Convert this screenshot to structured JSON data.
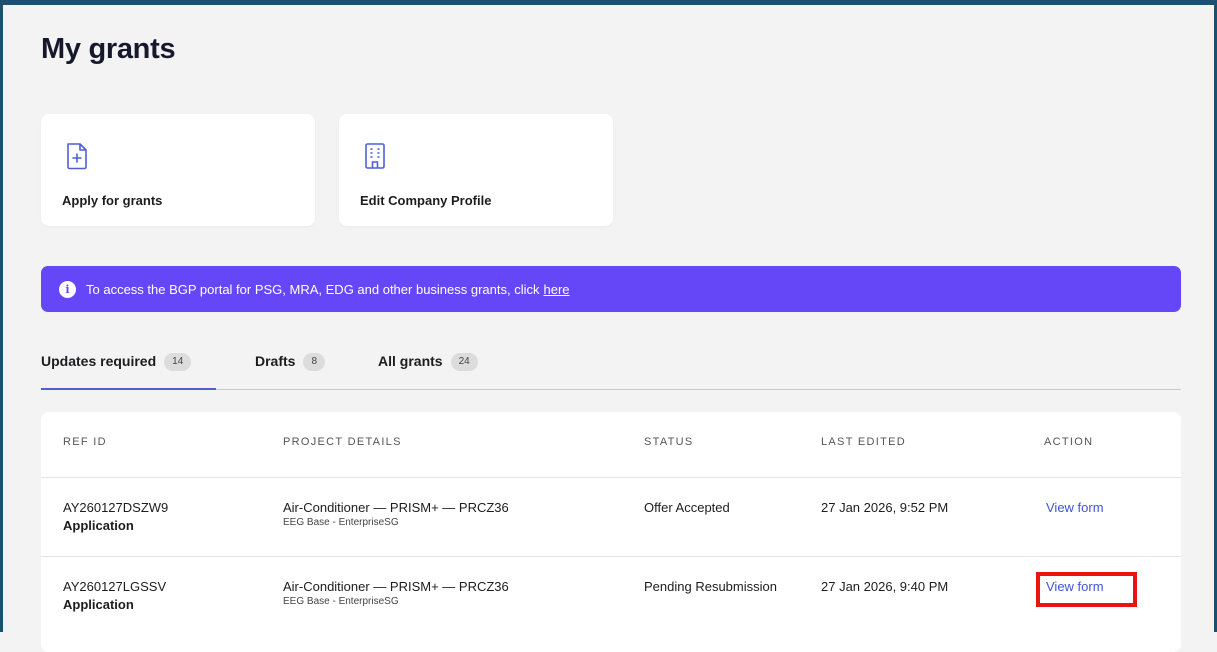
{
  "page": {
    "title": "My grants"
  },
  "cards": [
    {
      "label": "Apply for grants",
      "icon": "file-plus-icon"
    },
    {
      "label": "Edit Company Profile",
      "icon": "building-icon"
    }
  ],
  "banner": {
    "text": "To access the BGP portal for PSG, MRA, EDG and other business grants, click",
    "link": "here",
    "icon": "info-icon"
  },
  "tabs": [
    {
      "label": "Updates required",
      "count": "14",
      "active": true
    },
    {
      "label": "Drafts",
      "count": "8",
      "active": false
    },
    {
      "label": "All grants",
      "count": "24",
      "active": false
    }
  ],
  "table": {
    "headers": [
      "REF ID",
      "PROJECT DETAILS",
      "STATUS",
      "LAST EDITED",
      "ACTION"
    ],
    "rows": [
      {
        "ref_id": "AY260127DSZW9",
        "type": "Application",
        "project": "Air-Conditioner — PRISM+ — PRCZ36",
        "project_sub": "EEG Base - EnterpriseSG",
        "status": "Offer Accepted",
        "last_edited": "27 Jan 2026, 9:52 PM",
        "action": "View form"
      },
      {
        "ref_id": "AY260127LGSSV",
        "type": "Application",
        "project": "Air-Conditioner — PRISM+ — PRCZ36",
        "project_sub": "EEG Base - EnterpriseSG",
        "status": "Pending Resubmission",
        "last_edited": "27 Jan 2026, 9:40 PM",
        "action": "View form"
      }
    ]
  },
  "colors": {
    "brand_frame": "#1d4f6e",
    "banner_bg": "#6647f8",
    "link": "#3d55d6",
    "tab_active_underline": "#4f5fd8",
    "highlight": "#e8150f"
  }
}
